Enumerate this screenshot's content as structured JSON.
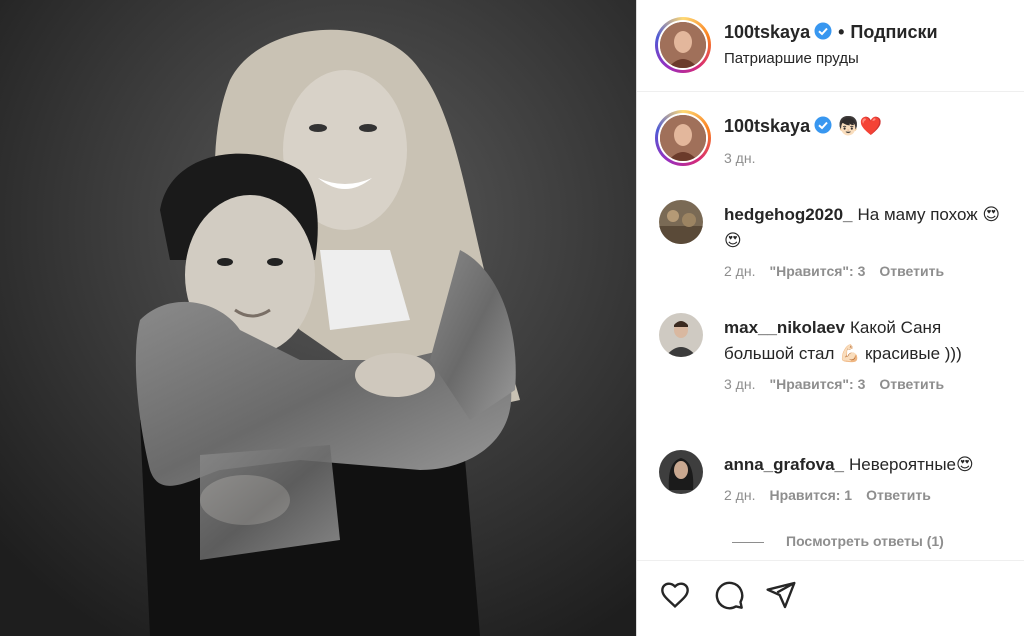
{
  "post": {
    "username": "100tskaya",
    "dot": "•",
    "follow_label": "Подписки",
    "location": "Патриаршие пруды"
  },
  "caption": {
    "username": "100tskaya",
    "emojis": "👦🏻❤️",
    "time": "3 дн."
  },
  "comments": [
    {
      "username": "hedgehog2020_",
      "text": "На маму похож 😍😍",
      "time": "2 дн.",
      "likes": "\"Нравится\": 3",
      "reply": "Ответить",
      "avatar_color": "#7a6a55"
    },
    {
      "username": "max__nikolaev",
      "text": "Какой Саня большой стал 💪🏻 красивые )))",
      "time": "3 дн.",
      "likes": "\"Нравится\": 3",
      "reply": "Ответить",
      "avatar_color": "#6d6d6d"
    },
    {
      "username": "anna_grafova_",
      "text": "Невероятные😍",
      "time": "2 дн.",
      "likes": "Нравится: 1",
      "reply": "Ответить",
      "avatar_color": "#4a4a4a"
    }
  ],
  "view_replies": "Посмотреть ответы (1)",
  "icons": {
    "like": "heart-icon",
    "comment": "comment-icon",
    "share": "share-icon",
    "verified": "verified-badge-icon"
  },
  "colors": {
    "verified": "#3897f0",
    "secondary_text": "#8e8e8e"
  }
}
